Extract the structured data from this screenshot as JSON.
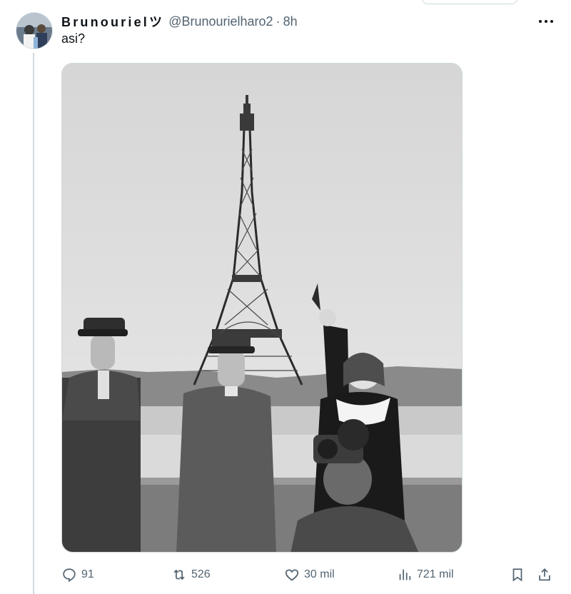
{
  "tweet": {
    "display_name": "Brunourielツ",
    "handle": "@Brunourielharo2",
    "separator": "·",
    "time": "8h",
    "text": "asi?",
    "media_alt": "Black-and-white photo in front of the Eiffel Tower"
  },
  "actions": {
    "replies": "91",
    "reposts": "526",
    "likes": "30 mil",
    "views": "721 mil"
  },
  "icons": {
    "reply": "reply-icon",
    "repost": "repost-icon",
    "like": "heart-icon",
    "views": "views-icon",
    "bookmark": "bookmark-icon",
    "share": "share-icon",
    "more": "more-icon"
  },
  "colors": {
    "text": "#0f1419",
    "secondary": "#536471",
    "border": "#cfd9de"
  }
}
